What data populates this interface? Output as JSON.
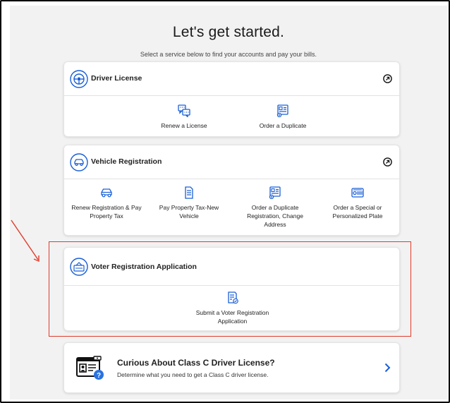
{
  "header": {
    "title": "Let's get started.",
    "subtitle": "Select a service below to find your accounts and pay your bills."
  },
  "driver_license": {
    "title": "Driver License",
    "icon": "driver-license-icon",
    "services": [
      {
        "label": "Renew a License",
        "icon": "chat-bubbles-icon"
      },
      {
        "label": "Order a Duplicate",
        "icon": "id-card-icon"
      }
    ]
  },
  "vehicle_registration": {
    "title": "Vehicle Registration",
    "icon": "car-icon",
    "services": [
      {
        "label": "Renew Registration & Pay Property Tax",
        "icon": "car-icon"
      },
      {
        "label": "Pay Property Tax-New Vehicle",
        "icon": "document-icon"
      },
      {
        "label": "Order a Duplicate Registration, Change Address",
        "icon": "id-card-icon"
      },
      {
        "label": "Order a Special or Personalized Plate",
        "icon": "license-plate-icon"
      }
    ]
  },
  "voter_registration": {
    "title": "Voter Registration Application",
    "icon": "vote-icon",
    "services": [
      {
        "label": "Submit a Voter Registration Application",
        "icon": "checklist-icon"
      }
    ]
  },
  "promo": {
    "title": "Curious About Class C Driver License?",
    "subtitle": "Determine what you need to get a Class C driver license."
  },
  "colors": {
    "accent": "#1a5fd6",
    "highlight": "#e03a2a",
    "background": "#f2f2f2"
  }
}
